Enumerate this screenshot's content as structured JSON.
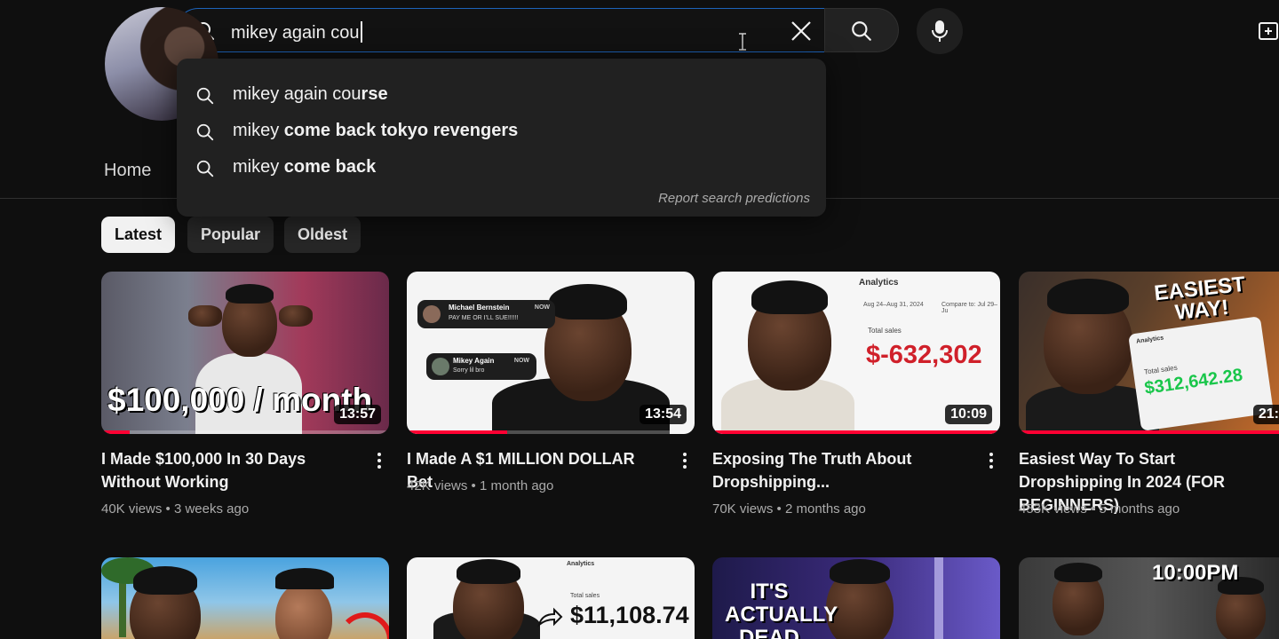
{
  "search": {
    "query": "mikey again cou",
    "suggestions": [
      {
        "typed": "mikey again cou",
        "rest": "rse"
      },
      {
        "typed": "mikey ",
        "rest": "come back tokyo revengers"
      },
      {
        "typed": "mikey ",
        "rest": "come back"
      }
    ],
    "report_label": "Report search predictions"
  },
  "nav": {
    "home_label": "Home"
  },
  "chips": [
    "Latest",
    "Popular",
    "Oldest"
  ],
  "videos": [
    {
      "title": "I Made $100,000 In 30 Days Without Working",
      "views": "40K views",
      "age": "3 weeks ago",
      "duration": "13:57",
      "thumb_text": "$100,000 / month",
      "progress": 0.1
    },
    {
      "title": "I Made A $1 MILLION DOLLAR Bet",
      "views": "42K views",
      "age": "1 month ago",
      "duration": "13:54",
      "thumb_text": "",
      "thumb_notifications": [
        {
          "name": "Michael Bernstein",
          "msg": "PAY ME OR I'LL SUE!!!!!!",
          "time": "NOW"
        },
        {
          "name": "Mikey Again",
          "msg": "Sorry lil bro",
          "time": "NOW"
        }
      ],
      "progress": 0.35
    },
    {
      "title": "Exposing The Truth About Dropshipping...",
      "views": "70K views",
      "age": "2 months ago",
      "duration": "10:09",
      "thumb_text": "$-632,302",
      "thumb_labels": {
        "header": "Analytics",
        "date": "Aug 24–Aug 31, 2024",
        "compare": "Compare to: Jul 29–Ju",
        "sales": "Total sales"
      },
      "progress": 1.0
    },
    {
      "title": "Easiest Way To Start Dropshipping In 2024 (FOR BEGINNERS)",
      "views": "453K views",
      "age": "5 months ago",
      "duration": "21:",
      "thumb_text": "$312,642.28",
      "thumb_labels": {
        "header": "Analytics",
        "sales": "Total sales",
        "badge": "EASIEST WAY!"
      },
      "progress": 1.0
    }
  ],
  "row2_thumbs": [
    {
      "thumb_text": ""
    },
    {
      "thumb_text": "$11,108.74",
      "header": "Analytics",
      "sales": "Total sales"
    },
    {
      "thumb_text": "IT'S ACTUALLY DEAD"
    },
    {
      "thumb_text": "10:00PM"
    }
  ],
  "colors": {
    "background": "#0f0f0f",
    "progress": "#ff0033",
    "search_focus": "#1c62b9",
    "loss": "#d0202a",
    "gain": "#19c64a"
  }
}
